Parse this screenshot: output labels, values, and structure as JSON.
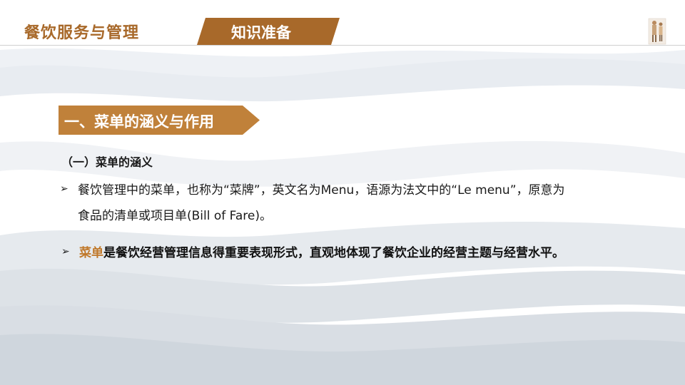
{
  "header": {
    "course_title": "餐饮服务与管理",
    "section_label": "知识准备"
  },
  "content": {
    "heading": "一、菜单的涵义与作用",
    "subheading": "（一）菜单的涵义",
    "bullets": [
      {
        "marker": "➢",
        "text": "餐饮管理中的菜单，也称为“菜牌”，英文名为Menu，语源为法文中的“Le menu”，原意为食品的清单或项目单(Bill of Fare)。"
      },
      {
        "marker": "➢",
        "highlight": "菜单",
        "text": "是餐饮经营管理信息得重要表现形式，直观地体现了餐饮企业的经营主题与经营水平。"
      }
    ]
  },
  "colors": {
    "accent": "#a8692a",
    "banner": "#c0813a",
    "highlight": "#c0782a"
  }
}
